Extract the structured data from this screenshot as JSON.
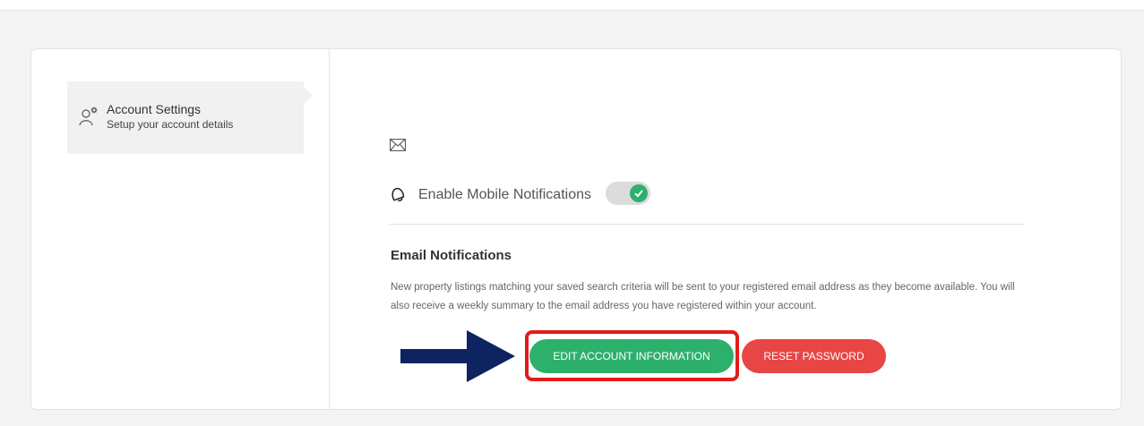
{
  "sidebar": {
    "items": [
      {
        "title": "Account Settings",
        "subtitle": "Setup your account details",
        "icon": "user-gear-icon"
      }
    ]
  },
  "notifications": {
    "email_icon": "envelope-icon",
    "mobile": {
      "icon": "bell-icon",
      "label": "Enable Mobile Notifications",
      "enabled": true
    }
  },
  "email_section": {
    "title": "Email Notifications",
    "description": "New property listings matching your saved search criteria will be sent to your registered email address as they become available. You will also receive a weekly summary to the email address you have registered within your account."
  },
  "actions": {
    "edit_label": "EDIT ACCOUNT INFORMATION",
    "reset_label": "RESET PASSWORD"
  },
  "colors": {
    "accent_green": "#2eb06d",
    "danger_red": "#e84545",
    "highlight_red": "#e41b1b",
    "arrow_navy": "#0d2460"
  }
}
